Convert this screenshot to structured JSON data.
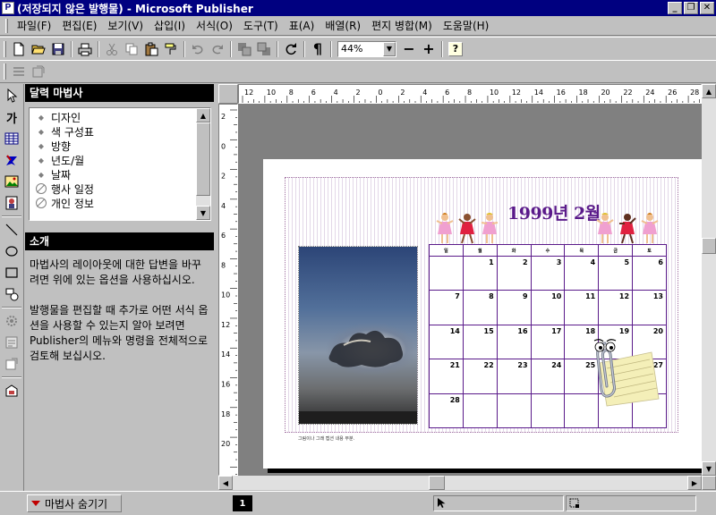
{
  "window": {
    "title": "(저장되지 않은 발행물) - Microsoft Publisher",
    "app_icon_letter": "P",
    "minimize": "_",
    "restore": "❐",
    "close": "✕"
  },
  "menu": [
    {
      "label": "파일(F)"
    },
    {
      "label": "편집(E)"
    },
    {
      "label": "보기(V)"
    },
    {
      "label": "삽입(I)"
    },
    {
      "label": "서식(O)"
    },
    {
      "label": "도구(T)"
    },
    {
      "label": "표(A)"
    },
    {
      "label": "배열(R)"
    },
    {
      "label": "편지 병합(M)"
    },
    {
      "label": "도움말(H)"
    }
  ],
  "toolbar": {
    "zoom": "44%",
    "zoom_out": "−",
    "zoom_in": "+",
    "paragraph": "¶",
    "help": "?"
  },
  "wizard": {
    "title": "달력 마법사",
    "items": [
      {
        "label": "디자인",
        "available": true
      },
      {
        "label": "색 구성표",
        "available": true
      },
      {
        "label": "방향",
        "available": true
      },
      {
        "label": "년도/월",
        "available": true
      },
      {
        "label": "날짜",
        "available": true
      },
      {
        "label": "행사 일정",
        "available": false
      },
      {
        "label": "개인 정보",
        "available": false
      }
    ],
    "intro_title": "소개",
    "intro_p1": "마법사의 레이아웃에 대한 답변을 바꾸려면 위에 있는 옵션을 사용하십시오.",
    "intro_p2": "발행물을 편집할 때 추가로 어떤 서식 옵션을 사용할 수 있는지 알아 보려면 Publisher의 메뉴와 명령을 전체적으로 검토해 보십시오.",
    "hide_button": "마법사 숨기기"
  },
  "rulers": {
    "top_labels": [
      "12",
      "10",
      "8",
      "6",
      "4",
      "2",
      "0",
      "2",
      "4",
      "6",
      "8",
      "10",
      "12",
      "14",
      "16",
      "18",
      "20",
      "22",
      "24",
      "26",
      "28"
    ],
    "left_labels": [
      "2",
      "0",
      "2",
      "4",
      "6",
      "8",
      "10",
      "12",
      "14",
      "16",
      "18",
      "20"
    ]
  },
  "calendar": {
    "title": "1999년 2월",
    "weekdays": [
      "일",
      "월",
      "화",
      "수",
      "목",
      "금",
      "토"
    ],
    "weeks": [
      [
        "",
        "1",
        "2",
        "3",
        "4",
        "5",
        "6"
      ],
      [
        "7",
        "8",
        "9",
        "10",
        "11",
        "12",
        "13"
      ],
      [
        "14",
        "15",
        "16",
        "17",
        "18",
        "19",
        "20"
      ],
      [
        "21",
        "22",
        "23",
        "24",
        "25",
        "26",
        "27"
      ],
      [
        "28",
        "",
        "",
        "",
        "",
        "",
        ""
      ]
    ],
    "caption": "그림이나 그래 캡션 내용 부분."
  },
  "status": {
    "page_number": "1"
  },
  "colors": {
    "titlebar": "#000080",
    "calendar_accent": "#5a1a8a",
    "workspace": "#808080"
  }
}
